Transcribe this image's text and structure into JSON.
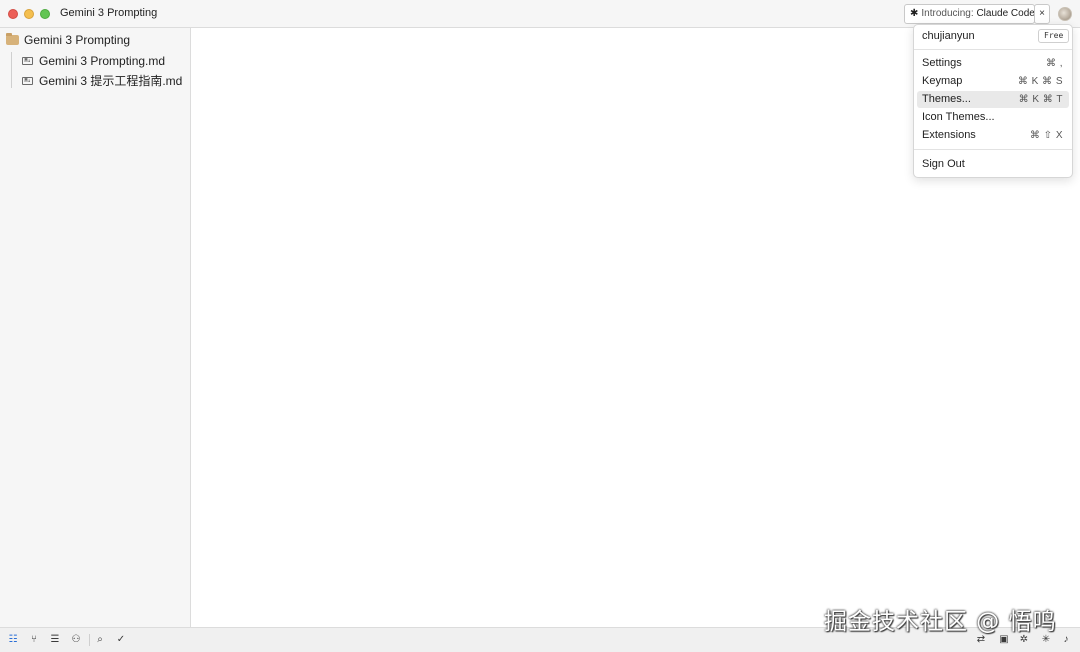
{
  "window": {
    "title": "Gemini 3 Prompting"
  },
  "announcement": {
    "prefix": "Introducing:",
    "product": "Claude Code",
    "close_label": "×"
  },
  "sidebar": {
    "root_folder": "Gemini 3 Prompting",
    "files": [
      {
        "name": "Gemini 3 Prompting.md",
        "icon": "markdown-file-icon"
      },
      {
        "name": "Gemini 3 提示工程指南.md",
        "icon": "markdown-file-icon"
      }
    ]
  },
  "user_menu": {
    "username": "chujianyun",
    "plan_badge": "Free",
    "items": [
      {
        "label": "Settings",
        "shortcut": "⌘ ,"
      },
      {
        "label": "Keymap",
        "shortcut": "⌘ K  ⌘ S"
      },
      {
        "label": "Themes...",
        "shortcut": "⌘ K  ⌘ T",
        "highlighted": true
      },
      {
        "label": "Icon Themes...",
        "shortcut": ""
      },
      {
        "label": "Extensions",
        "shortcut": "⌘ ⇧ X"
      }
    ],
    "sign_out_label": "Sign Out"
  },
  "statusbar": {
    "left_icons": [
      "project-panel-icon",
      "git-branch-icon",
      "outline-icon",
      "collab-icon",
      "search-icon",
      "diagnostics-check-icon"
    ],
    "right_icons": [
      "language-icon",
      "terminal-icon",
      "debug-icon",
      "assistant-icon",
      "notification-bell-icon"
    ],
    "accent_color": "#2b6fd6"
  },
  "watermark": {
    "text": "掘金技术社区 @ 悟鸣"
  }
}
